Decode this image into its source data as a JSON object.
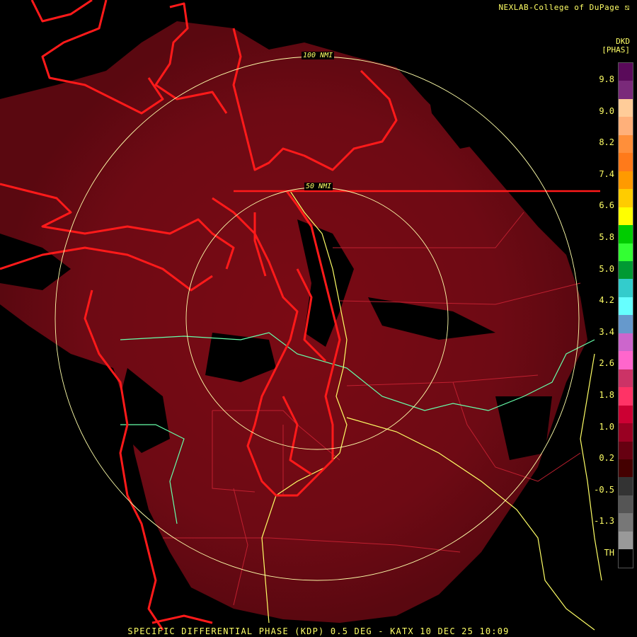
{
  "header": {
    "credit": "NEXLAB-College of DuPage ⧅"
  },
  "legend": {
    "product": "DKD",
    "units": "[PHAS]",
    "labels": [
      "9.8",
      "9.0",
      "8.2",
      "7.4",
      "6.6",
      "5.8",
      "5.0",
      "4.2",
      "3.4",
      "2.6",
      "1.8",
      "1.0",
      "0.2",
      "-0.5",
      "-1.3",
      "TH"
    ],
    "colors": [
      "#5a0a5a",
      "#7a2a7a",
      "#ffcc99",
      "#ffb07a",
      "#ff8f3a",
      "#ff7a1a",
      "#ff9a00",
      "#ffcc00",
      "#ffff00",
      "#00cc00",
      "#33ff33",
      "#009933",
      "#33cccc",
      "#66ffff",
      "#6699cc",
      "#cc66cc",
      "#ff66cc",
      "#cc3366",
      "#ff3366",
      "#cc0033",
      "#990022",
      "#660011",
      "#440000",
      "#333333",
      "#555555",
      "#777777",
      "#999999",
      "#000000"
    ]
  },
  "rings": {
    "inner": "50 NMI",
    "outer": "100 NMI"
  },
  "footer": {
    "title": "SPECIFIC DIFFERENTIAL PHASE (KDP) 0.5 DEG - KATX 10 DEC 25 10:09"
  }
}
